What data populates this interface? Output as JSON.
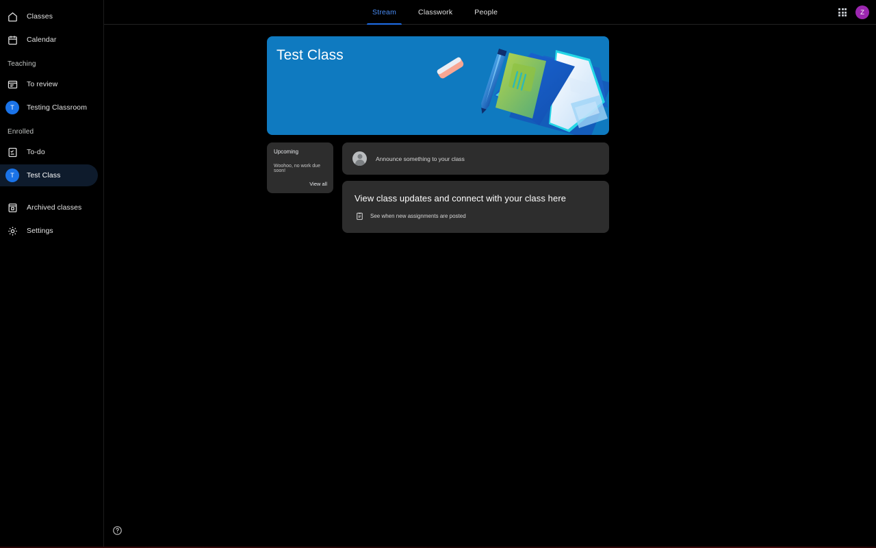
{
  "sidebar": {
    "top_items": [
      {
        "label": "Classes",
        "icon": "home-icon"
      },
      {
        "label": "Calendar",
        "icon": "calendar-icon"
      }
    ],
    "teaching_header": "Teaching",
    "teaching_items": [
      {
        "label": "To review",
        "icon": "to-review-icon",
        "type": "icon"
      },
      {
        "label": "Testing Classroom",
        "icon": "class-avatar",
        "type": "avatar",
        "initial": "T",
        "avatar_color": "#1a73e8"
      }
    ],
    "enrolled_header": "Enrolled",
    "enrolled_items": [
      {
        "label": "To-do",
        "icon": "todo-icon",
        "type": "icon",
        "selected": false
      },
      {
        "label": "Test Class",
        "icon": "class-avatar",
        "type": "avatar",
        "initial": "T",
        "avatar_color": "#1a73e8",
        "selected": true
      }
    ],
    "bottom_items": [
      {
        "label": "Archived classes",
        "icon": "archive-icon"
      },
      {
        "label": "Settings",
        "icon": "gear-icon"
      }
    ],
    "help_icon": "help-circle-icon"
  },
  "header": {
    "tabs": [
      {
        "label": "Stream",
        "active": true
      },
      {
        "label": "Classwork",
        "active": false
      },
      {
        "label": "People",
        "active": false
      }
    ],
    "apps_icon": "apps-grid-icon",
    "account_initial": "Z",
    "account_color": "#9c27b0"
  },
  "banner": {
    "title": "Test Class",
    "background_color": "#0f7ac0",
    "illustration": "books-pen-eraser-illustration"
  },
  "upcoming_card": {
    "title": "Upcoming",
    "body": "Woohoo, no work due soon!",
    "link": "View all"
  },
  "announce_box": {
    "avatar": "user-avatar-placeholder",
    "placeholder": "Announce something to your class"
  },
  "updates_card": {
    "heading": "View class updates and connect with your class here",
    "row_icon": "assignment-icon",
    "row_text": "See when new assignments are posted"
  }
}
